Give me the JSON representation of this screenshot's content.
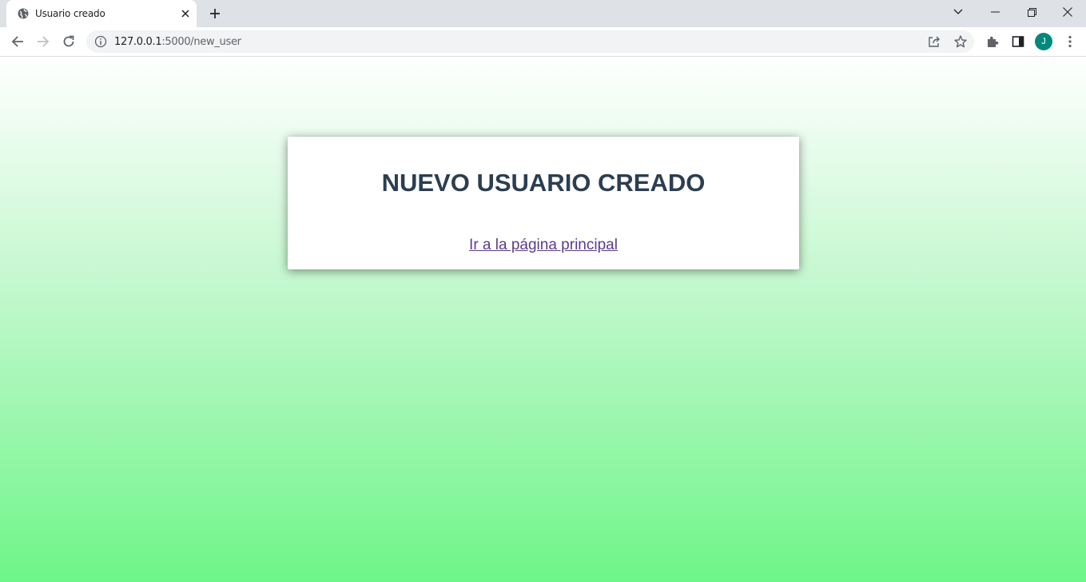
{
  "browser": {
    "tab": {
      "title": "Usuario creado",
      "favicon": "globe-icon"
    },
    "new_tab_icon": "plus-icon",
    "window_controls": [
      "chevron-down-icon",
      "minimize-icon",
      "restore-icon",
      "close-icon"
    ],
    "address_bar": {
      "host": "127.0.0.1",
      "rest": ":5000/new_user"
    },
    "profile_initial": "J",
    "avatar_color": "#00897b"
  },
  "page": {
    "heading": "NUEVO USUARIO CREADO",
    "home_link": "Ir a la página principal",
    "heading_color": "#2c3e50",
    "link_color": "#5b3b8c",
    "gradient": [
      "#ffffff",
      "#6ef588"
    ]
  }
}
